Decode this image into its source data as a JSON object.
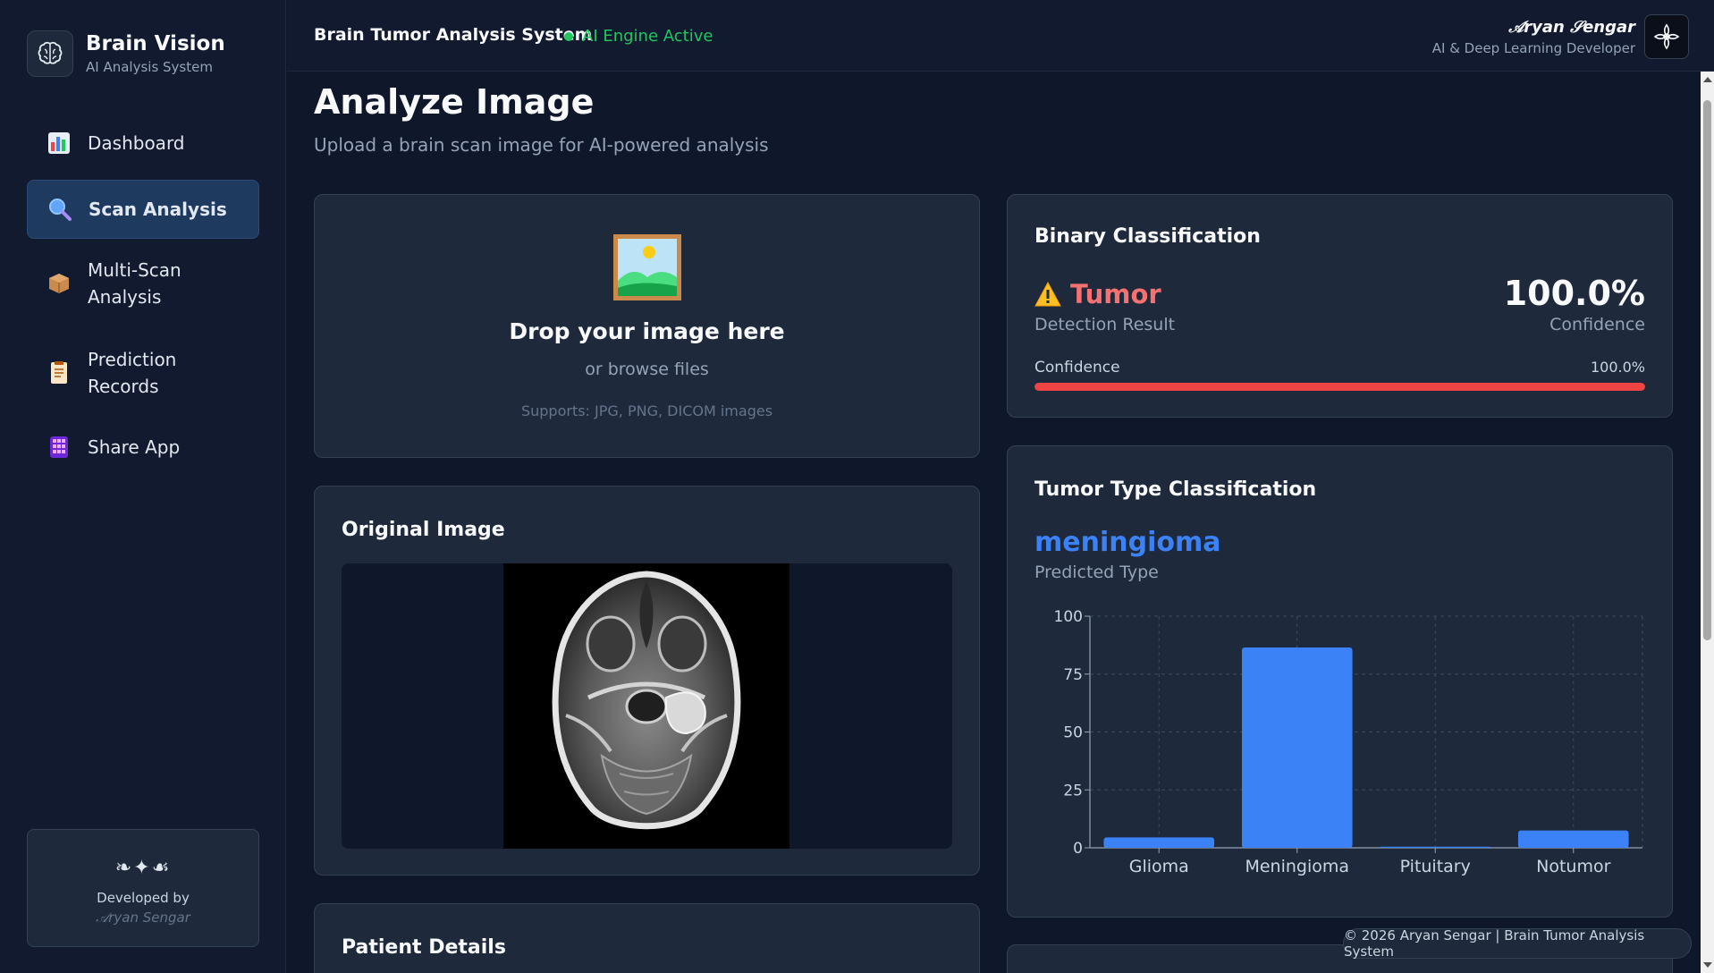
{
  "brand": {
    "title": "Brain Vision",
    "subtitle": "AI Analysis System",
    "icon": "brain-icon"
  },
  "nav": {
    "items": [
      {
        "label": "Dashboard",
        "icon": "bar-chart-icon"
      },
      {
        "label": "Scan Analysis",
        "icon": "magnifier-icon",
        "active": true
      },
      {
        "label_lines": [
          "Multi-Scan",
          "Analysis"
        ],
        "icon": "package-icon"
      },
      {
        "label_lines": [
          "Prediction",
          "Records"
        ],
        "icon": "document-icon"
      },
      {
        "label": "Share App",
        "icon": "apps-grid-icon"
      }
    ]
  },
  "developer_card": {
    "ornament": "❧✦☙",
    "by": "Developed by",
    "name": "𝒜ryan Sengar"
  },
  "topbar": {
    "title": "Brain Tumor Analysis System",
    "status": "AI Engine Active",
    "status_color": "#22c55e",
    "user_name": "𝒜ryan 𝒮engar",
    "user_role": "AI & Deep Learning Developer"
  },
  "page": {
    "title": "Analyze Image",
    "subtitle": "Upload a brain scan image for AI-powered analysis"
  },
  "upload": {
    "icon": "picture-icon",
    "title": "Drop your image here",
    "browse": "or browse files",
    "supports": "Supports: JPG, PNG, DICOM images"
  },
  "original_image": {
    "title": "Original Image"
  },
  "patient_details": {
    "title": "Patient Details"
  },
  "binary": {
    "title": "Binary Classification",
    "result": "Tumor",
    "result_color": "#f87171",
    "result_caption": "Detection Result",
    "confidence": "100.0%",
    "confidence_caption": "Confidence",
    "bar_label": "Confidence",
    "bar_value": "100.0%",
    "bar_fraction": 1.0,
    "bar_color": "#ef4444"
  },
  "tumor_type": {
    "title": "Tumor Type Classification",
    "predicted": "meningioma",
    "predicted_caption": "Predicted Type"
  },
  "chart_data": {
    "type": "bar",
    "categories": [
      "Glioma",
      "Meningioma",
      "Pituitary",
      "Notumor"
    ],
    "values": [
      4.5,
      86.5,
      0.5,
      7.5
    ],
    "ylim": [
      0,
      100
    ],
    "yticks": [
      0,
      25,
      50,
      75,
      100
    ],
    "grid": true,
    "bar_color": "#3b82f6",
    "title": "",
    "xlabel": "",
    "ylabel": ""
  },
  "footer": {
    "text": "© 2026 Aryan Sengar | Brain Tumor Analysis System"
  }
}
